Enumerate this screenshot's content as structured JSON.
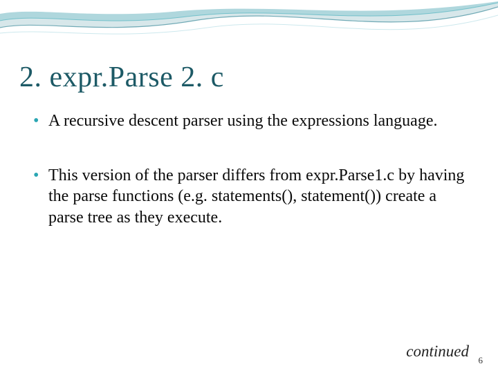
{
  "title": "2.  expr.Parse 2. c",
  "bullets": [
    "A recursive descent parser using the expressions language.",
    "This version of the parser differs from expr.Parse1.c by having the parse functions (e.g. statements(), statement()) create a parse tree as they execute."
  ],
  "continued": "continued",
  "pagenum": "6",
  "colors": {
    "title": "#1d5a66",
    "bullet_marker": "#2aa6b3",
    "swoosh_outer": "#1f7a8c",
    "swoosh_mid": "#9fd7df",
    "swoosh_inner": "#ffffff"
  }
}
